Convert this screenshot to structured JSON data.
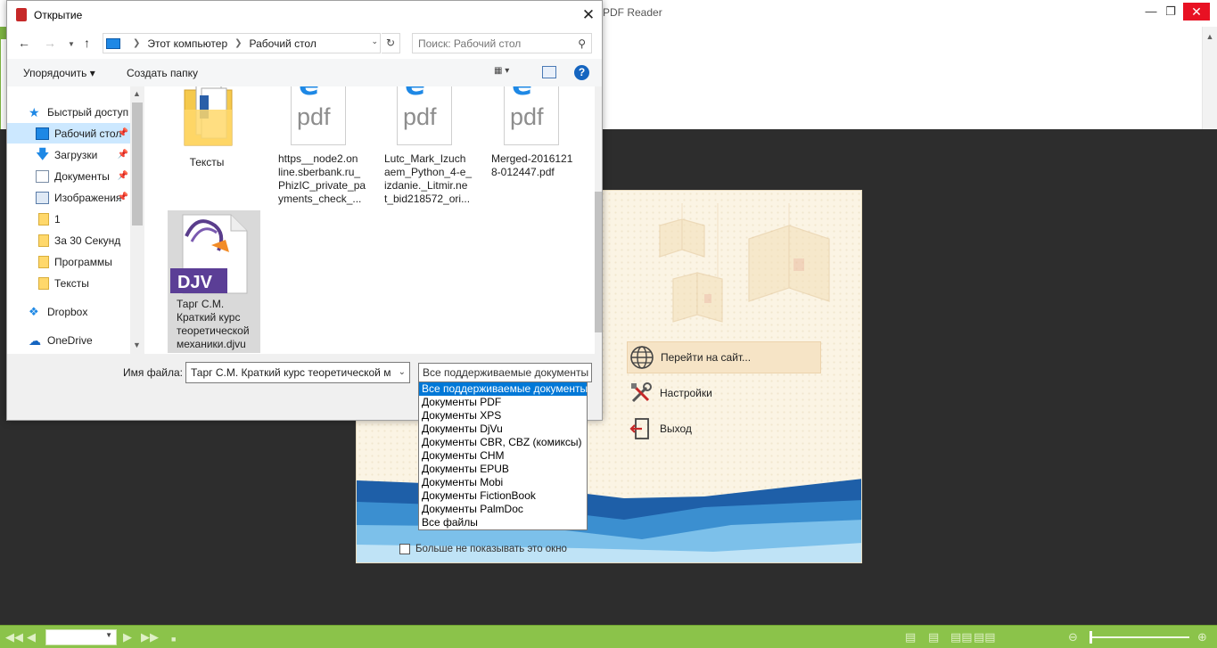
{
  "app": {
    "title": "PDF Reader",
    "welcome": {
      "menu": [
        {
          "label": "Перейти на сайт...",
          "icon": "globe-icon"
        },
        {
          "label": "Настройки",
          "icon": "tools-icon"
        },
        {
          "label": "Выход",
          "icon": "exit-icon"
        }
      ],
      "dont_show_label": "Больше не показывать это окно"
    }
  },
  "dialog": {
    "title": "Открытие",
    "breadcrumb": [
      "Этот компьютер",
      "Рабочий стол"
    ],
    "search_placeholder": "Поиск: Рабочий стол",
    "toolbar": {
      "organize": "Упорядочить ▾",
      "new_folder": "Создать папку"
    },
    "nav": [
      {
        "label": "Быстрый доступ",
        "icon": "star-icon"
      },
      {
        "label": "Рабочий стол",
        "icon": "desktop-icon",
        "selected": true,
        "pinned": true
      },
      {
        "label": "Загрузки",
        "icon": "download-icon",
        "pinned": true
      },
      {
        "label": "Документы",
        "icon": "documents-icon",
        "pinned": true
      },
      {
        "label": "Изображения",
        "icon": "pictures-icon",
        "pinned": true
      },
      {
        "label": "1",
        "icon": "folder-icon"
      },
      {
        "label": "За 30 Секунд",
        "icon": "folder-icon"
      },
      {
        "label": "Программы",
        "icon": "folder-icon"
      },
      {
        "label": "Тексты",
        "icon": "folder-icon"
      },
      {
        "label": "Dropbox",
        "icon": "dropbox-icon"
      },
      {
        "label": "OneDrive",
        "icon": "onedrive-icon"
      }
    ],
    "files": [
      {
        "name": "Тексты",
        "type": "folder"
      },
      {
        "name": "https__node2.on\nline.sberbank.ru_\nPhizIC_private_pa\nyments_check_...",
        "type": "pdf"
      },
      {
        "name": "Lutc_Mark_Izuch\naem_Python_4-e_\nizdanie._Litmir.ne\nt_bid218572_ori...",
        "type": "pdf"
      },
      {
        "name": "Merged-2016121\n8-012447.pdf",
        "type": "pdf"
      },
      {
        "name": "Тарг С.М.\nКраткий курс\nтеоретической\nмеханики.djvu",
        "type": "djvu",
        "selected": true
      }
    ],
    "djv_badge": "DJV",
    "pdf_icon_text": "pdf",
    "filename_label": "Имя файла:",
    "filename_value": "Тарг С.М. Краткий курс теоретической м",
    "filter_selected": "Все поддерживаемые документы",
    "filter_options": [
      "Все поддерживаемые документы",
      "Документы PDF",
      "Документы XPS",
      "Документы DjVu",
      "Документы CBR, CBZ (комиксы)",
      "Документы CHM",
      "Документы EPUB",
      "Документы Mobi",
      "Документы FictionBook",
      "Документы PalmDoc",
      "Все файлы"
    ],
    "highlighted_option_index": 0
  },
  "colors": {
    "accent_green": "#8bc34a",
    "selection_blue": "#0078d7",
    "nav_selected": "#cce8ff"
  }
}
